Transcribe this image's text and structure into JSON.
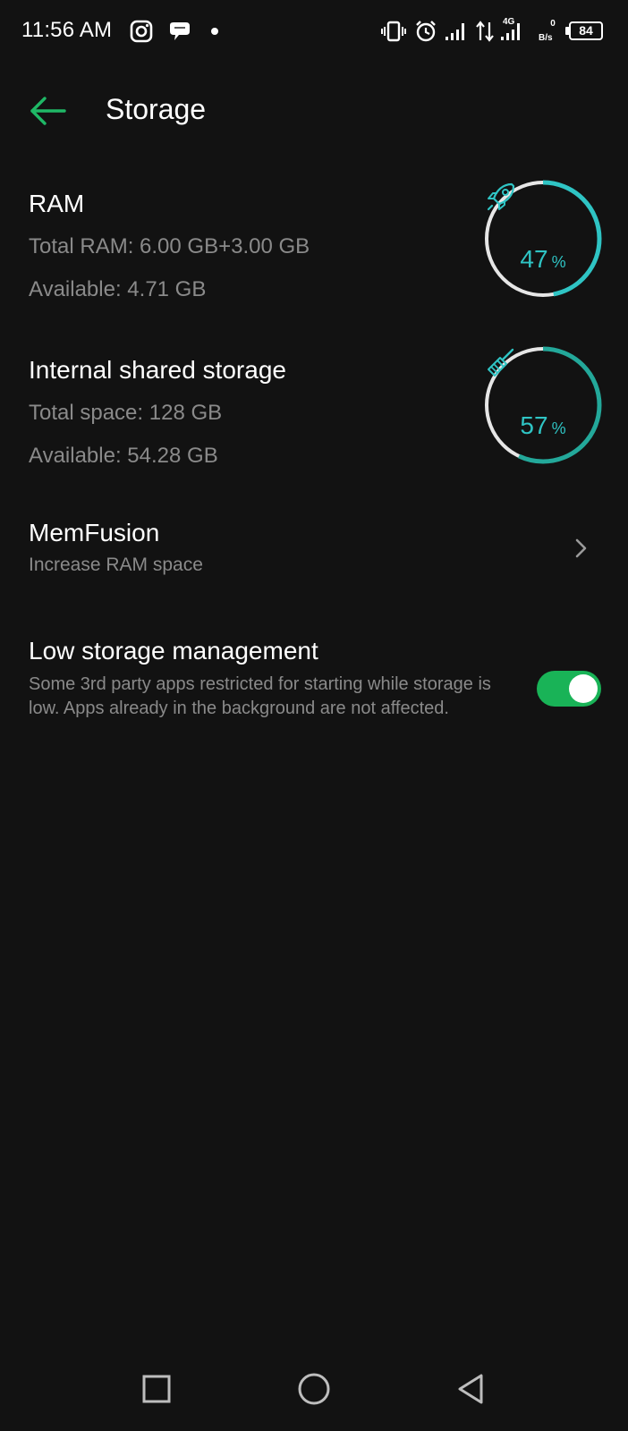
{
  "status_bar": {
    "time": "11:56 AM",
    "icons": [
      "instagram-icon",
      "chat-bubble-icon",
      "dot-icon",
      "vibrate-icon",
      "alarm-icon",
      "signal-icon",
      "data-arrows-icon",
      "signal-4g-icon",
      "battery-icon"
    ],
    "network_type": "4G",
    "speed_value": "0",
    "speed_unit": "B/s",
    "battery_level": "84"
  },
  "header": {
    "title": "Storage",
    "back_icon": "arrow-left-icon",
    "accent_color": "#1fb866"
  },
  "ram": {
    "title": "RAM",
    "total": "Total RAM: 6.00 GB+3.00 GB",
    "available": "Available: 4.71 GB",
    "percent_value": "47",
    "percent_sign": "%",
    "percent_fraction": 0.47,
    "icon": "rocket-icon",
    "gauge_color": "#2fc4c4"
  },
  "storage": {
    "title": "Internal shared storage",
    "total": "Total space: 128 GB",
    "available": "Available: 54.28 GB",
    "percent_value": "57",
    "percent_sign": "%",
    "percent_fraction": 0.57,
    "icon": "broom-icon",
    "gauge_color": "#23a89a"
  },
  "memfusion": {
    "title": "MemFusion",
    "subtitle": "Increase RAM space",
    "icon": "chevron-right-icon"
  },
  "low_storage": {
    "title": "Low storage management",
    "description": "Some 3rd party apps restricted for starting while storage is low. Apps already in the background are not affected.",
    "enabled": true,
    "toggle_color": "#19b357"
  },
  "nav_bar": {
    "icons": [
      "recents-square-icon",
      "home-circle-icon",
      "back-triangle-icon"
    ]
  }
}
